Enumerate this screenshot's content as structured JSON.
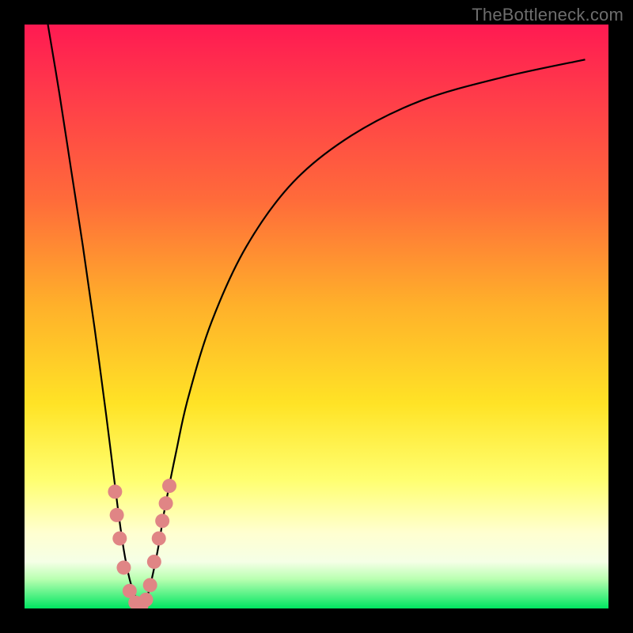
{
  "watermark": "TheBottleneck.com",
  "chart_data": {
    "type": "line",
    "title": "",
    "xlabel": "",
    "ylabel": "",
    "xlim": [
      0,
      100
    ],
    "ylim": [
      0,
      100
    ],
    "series": [
      {
        "name": "bottleneck-curve",
        "x": [
          4,
          6,
          8,
          10,
          12,
          14,
          15,
          16,
          17,
          18,
          19,
          20,
          21,
          22,
          23,
          24,
          26,
          28,
          32,
          38,
          46,
          56,
          68,
          82,
          96
        ],
        "y": [
          100,
          88,
          75,
          62,
          48,
          33,
          25,
          17,
          10,
          5,
          2,
          0,
          2,
          6,
          11,
          17,
          27,
          36,
          49,
          62,
          73,
          81,
          87,
          91,
          94
        ]
      }
    ],
    "markers": {
      "name": "highlight-dots",
      "color": "#e08585",
      "points": [
        {
          "x": 15.5,
          "y": 20
        },
        {
          "x": 15.8,
          "y": 16
        },
        {
          "x": 16.3,
          "y": 12
        },
        {
          "x": 17.0,
          "y": 7
        },
        {
          "x": 18.0,
          "y": 3
        },
        {
          "x": 19.0,
          "y": 1
        },
        {
          "x": 20.0,
          "y": 0.5
        },
        {
          "x": 20.8,
          "y": 1.5
        },
        {
          "x": 21.5,
          "y": 4
        },
        {
          "x": 22.2,
          "y": 8
        },
        {
          "x": 23.0,
          "y": 12
        },
        {
          "x": 23.6,
          "y": 15
        },
        {
          "x": 24.2,
          "y": 18
        },
        {
          "x": 24.8,
          "y": 21
        }
      ]
    }
  }
}
